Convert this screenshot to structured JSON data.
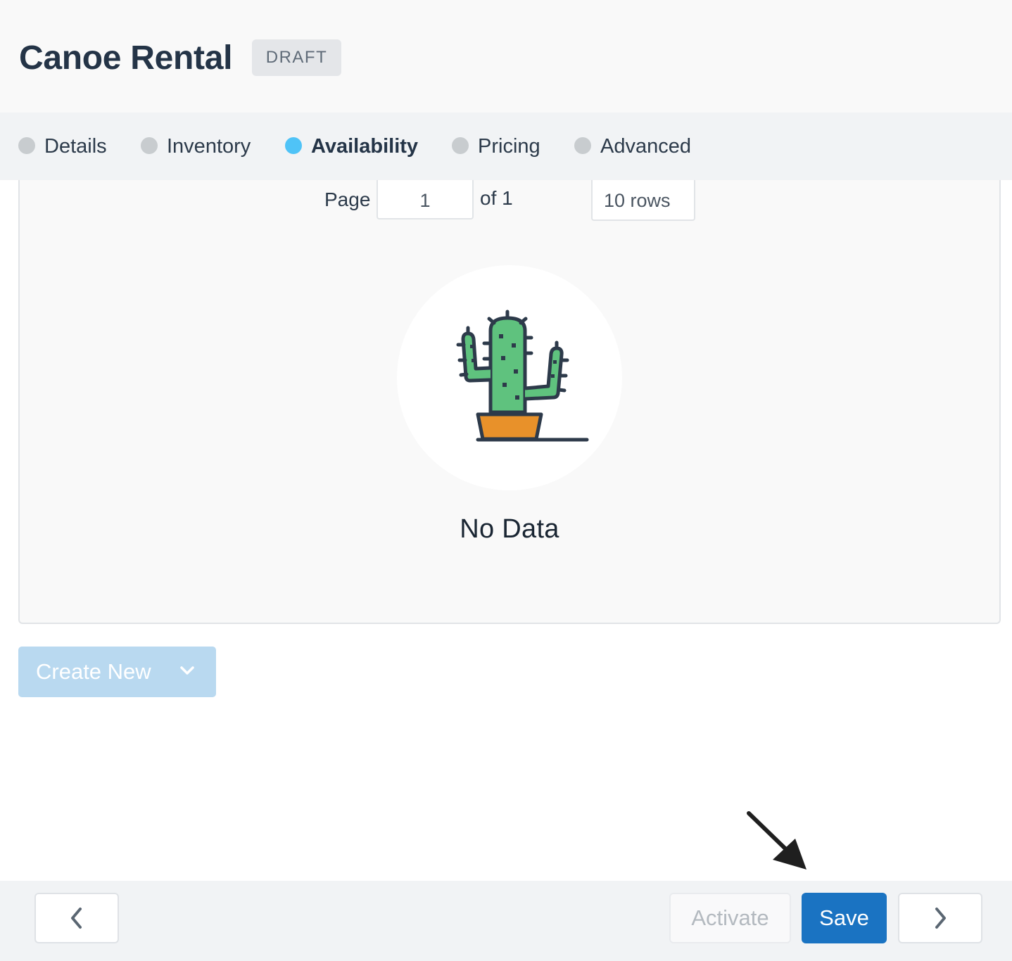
{
  "header": {
    "title": "Canoe Rental",
    "status_badge": "DRAFT"
  },
  "tabs": [
    {
      "label": "Details",
      "active": false
    },
    {
      "label": "Inventory",
      "active": false
    },
    {
      "label": "Availability",
      "active": true
    },
    {
      "label": "Pricing",
      "active": false
    },
    {
      "label": "Advanced",
      "active": false
    }
  ],
  "pagination": {
    "page_label": "Page",
    "current_page": "1",
    "of_label": "of 1",
    "rows_per_page": "10 rows"
  },
  "empty_state": {
    "message": "No Data",
    "icon": "cactus-icon"
  },
  "actions": {
    "create_new_label": "Create New",
    "activate_label": "Activate",
    "save_label": "Save"
  },
  "colors": {
    "accent": "#1a73c2",
    "active_tab_dot": "#4fc3f7",
    "inactive_tab_dot": "#c8cccf",
    "cactus_green": "#5fc27e",
    "pot_orange": "#e8912a"
  }
}
